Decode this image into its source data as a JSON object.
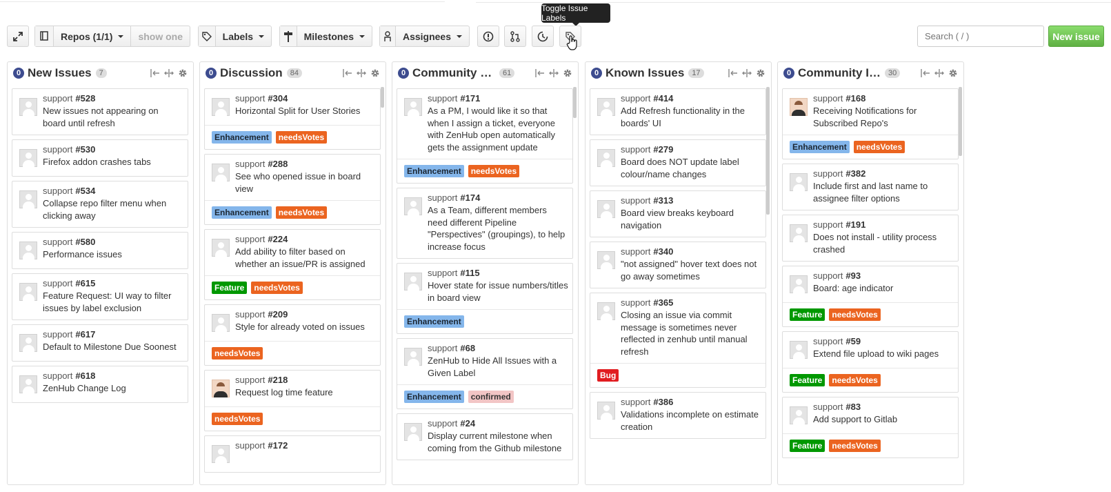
{
  "tooltip": "Toggle Issue Labels",
  "toolbar": {
    "repos_label": "Repos (1/1)",
    "show_one_label": "show one",
    "labels_label": "Labels",
    "milestones_label": "Milestones",
    "assignees_label": "Assignees",
    "search_placeholder": "Search ( / )",
    "new_issue_label": "New issue"
  },
  "pipelines": [
    {
      "badge": "0",
      "title": "New Issues",
      "count": "7",
      "cards": [
        {
          "repo": "support",
          "num": "#528",
          "title": "New issues not appearing on board until refresh",
          "labels": []
        },
        {
          "repo": "support",
          "num": "#530",
          "title": "Firefox addon crashes tabs",
          "labels": []
        },
        {
          "repo": "support",
          "num": "#534",
          "title": "Collapse repo filter menu when clicking away",
          "labels": []
        },
        {
          "repo": "support",
          "num": "#580",
          "title": "Performance issues",
          "labels": []
        },
        {
          "repo": "support",
          "num": "#615",
          "title": "Feature Request: UI way to filter issues by label exclusion",
          "labels": []
        },
        {
          "repo": "support",
          "num": "#617",
          "title": "Default to Milestone Due Soonest",
          "labels": []
        },
        {
          "repo": "support",
          "num": "#618",
          "title": "ZenHub Change Log",
          "labels": []
        }
      ]
    },
    {
      "badge": "0",
      "title": "Discussion",
      "count": "84",
      "cards": [
        {
          "repo": "support",
          "num": "#304",
          "title": "Horizontal Split for User Stories",
          "labels": [
            "Enhancement",
            "needsVotes"
          ]
        },
        {
          "repo": "support",
          "num": "#288",
          "title": "See who opened issue in board view",
          "labels": [
            "Enhancement",
            "needsVotes"
          ]
        },
        {
          "repo": "support",
          "num": "#224",
          "title": "Add ability to filter based on whether an issue/PR is assigned",
          "labels": [
            "Feature",
            "needsVotes"
          ]
        },
        {
          "repo": "support",
          "num": "#209",
          "title": "Style for already voted on issues",
          "labels": [
            "needsVotes"
          ]
        },
        {
          "repo": "support",
          "num": "#218",
          "title": "Request log time feature",
          "labels": [
            "needsVotes"
          ],
          "photo": true
        },
        {
          "repo": "support",
          "num": "#172",
          "title": "",
          "labels": []
        }
      ]
    },
    {
      "badge": "0",
      "title": "Community Ba...",
      "count": "61",
      "cards": [
        {
          "repo": "support",
          "num": "#171",
          "title": "As a PM, I would like it so that when I assign a ticket, everyone with ZenHub open automatically gets the assignment update",
          "labels": [
            "Enhancement",
            "needsVotes"
          ]
        },
        {
          "repo": "support",
          "num": "#174",
          "title": "As a Team, different members need different Pipeline \"Perspectives\" (groupings), to help increase focus",
          "labels": []
        },
        {
          "repo": "support",
          "num": "#115",
          "title": "Hover state for issue numbers/titles in board view",
          "labels": [
            "Enhancement"
          ]
        },
        {
          "repo": "support",
          "num": "#68",
          "title": "ZenHub to Hide All Issues with a Given Label",
          "labels": [
            "Enhancement",
            "confirmed"
          ]
        },
        {
          "repo": "support",
          "num": "#24",
          "title": "Display current milestone when coming from the Github milestone",
          "labels": []
        }
      ]
    },
    {
      "badge": "0",
      "title": "Known Issues",
      "count": "17",
      "cards": [
        {
          "repo": "support",
          "num": "#414",
          "title": "Add Refresh functionality in the boards' UI",
          "labels": []
        },
        {
          "repo": "support",
          "num": "#279",
          "title": "Board does NOT update label colour/name changes",
          "labels": []
        },
        {
          "repo": "support",
          "num": "#313",
          "title": "Board view breaks keyboard navigation",
          "labels": []
        },
        {
          "repo": "support",
          "num": "#340",
          "title": "\"not assigned\" hover text does not go away sometimes",
          "labels": []
        },
        {
          "repo": "support",
          "num": "#365",
          "title": "Closing an issue via commit message is sometimes never reflected in zenhub until manual refresh",
          "labels": [
            "Bug"
          ]
        },
        {
          "repo": "support",
          "num": "#386",
          "title": "Validations incomplete on estimate creation",
          "labels": []
        }
      ]
    },
    {
      "badge": "0",
      "title": "Community Ice...",
      "count": "30",
      "cards": [
        {
          "repo": "support",
          "num": "#168",
          "title": "Receiving Notifications for Subscribed Repo's",
          "labels": [
            "Enhancement",
            "needsVotes"
          ],
          "photo": true
        },
        {
          "repo": "support",
          "num": "#382",
          "title": "Include first and last name to assignee filter options",
          "labels": []
        },
        {
          "repo": "support",
          "num": "#191",
          "title": "Does not install - utility process crashed",
          "labels": []
        },
        {
          "repo": "support",
          "num": "#93",
          "title": "Board: age indicator",
          "labels": [
            "Feature",
            "needsVotes"
          ]
        },
        {
          "repo": "support",
          "num": "#59",
          "title": "Extend file upload to wiki pages",
          "labels": [
            "Feature",
            "needsVotes"
          ]
        },
        {
          "repo": "support",
          "num": "#83",
          "title": "Add support to Gitlab",
          "labels": [
            "Feature",
            "needsVotes"
          ]
        }
      ]
    }
  ]
}
